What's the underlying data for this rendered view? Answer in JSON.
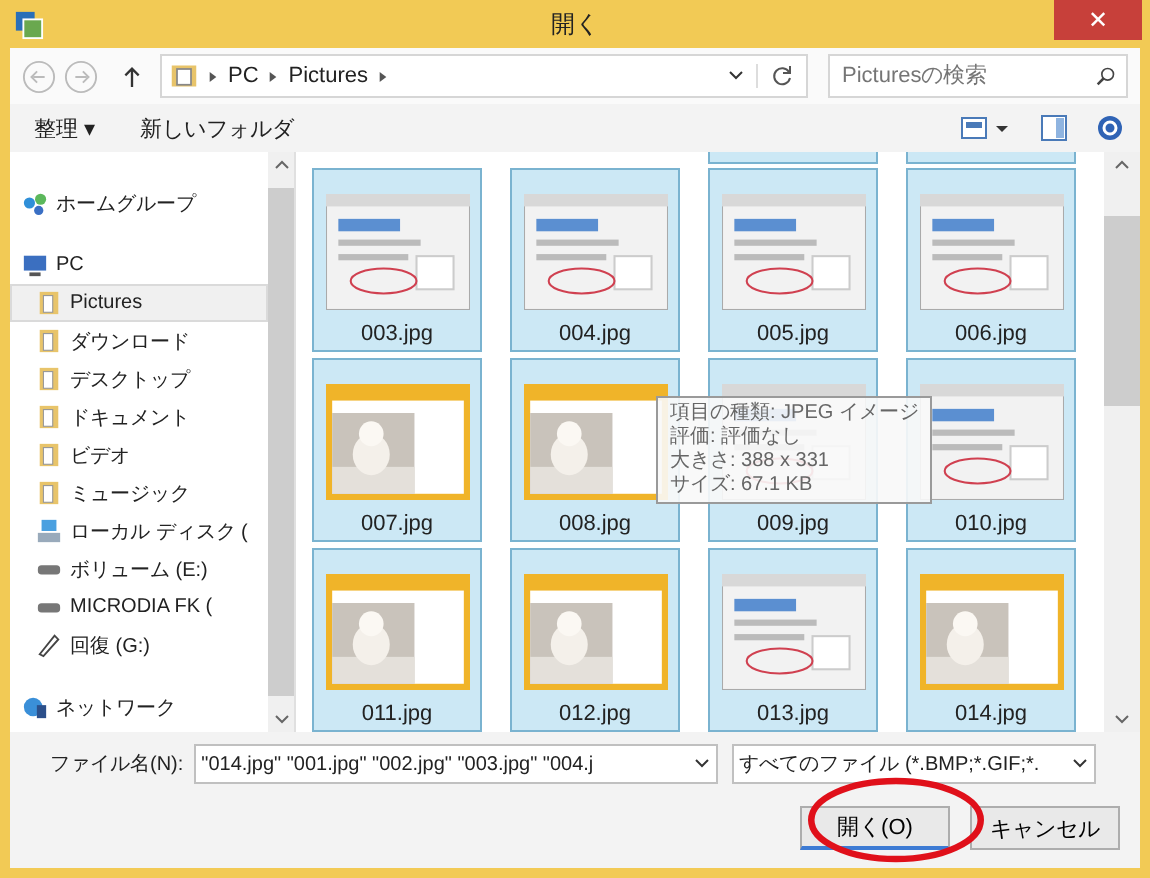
{
  "window": {
    "title": "開く",
    "close": "✕"
  },
  "address": {
    "crumbs": [
      "PC",
      "Pictures"
    ],
    "search_placeholder": "Picturesの検索"
  },
  "toolbar": {
    "organize": "整理 ▾",
    "new_folder": "新しいフォルダ"
  },
  "sidebar": {
    "items": [
      {
        "label": "ホームグループ",
        "kind": "homegroup",
        "selected": false
      },
      {
        "label": "PC",
        "kind": "pc",
        "selected": false,
        "children": [
          {
            "label": "Pictures",
            "kind": "folder",
            "selected": true
          },
          {
            "label": "ダウンロード",
            "kind": "folder",
            "selected": false
          },
          {
            "label": "デスクトップ",
            "kind": "folder",
            "selected": false
          },
          {
            "label": "ドキュメント",
            "kind": "folder",
            "selected": false
          },
          {
            "label": "ビデオ",
            "kind": "folder",
            "selected": false
          },
          {
            "label": "ミュージック",
            "kind": "folder",
            "selected": false
          },
          {
            "label": "ローカル ディスク (",
            "kind": "disk",
            "selected": false
          },
          {
            "label": "ボリューム (E:)",
            "kind": "drive",
            "selected": false
          },
          {
            "label": "MICRODIA FK (",
            "kind": "drive",
            "selected": false
          },
          {
            "label": "回復 (G:)",
            "kind": "pen",
            "selected": false
          }
        ]
      },
      {
        "label": "ネットワーク",
        "kind": "network",
        "selected": false
      }
    ]
  },
  "files": [
    {
      "name": "003.jpg",
      "kind": "screen",
      "selected": true
    },
    {
      "name": "004.jpg",
      "kind": "screen",
      "selected": true
    },
    {
      "name": "005.jpg",
      "kind": "screen",
      "selected": true
    },
    {
      "name": "006.jpg",
      "kind": "screen",
      "selected": true
    },
    {
      "name": "007.jpg",
      "kind": "dog",
      "selected": true
    },
    {
      "name": "008.jpg",
      "kind": "dog",
      "selected": true
    },
    {
      "name": "009.jpg",
      "kind": "screen",
      "selected": true
    },
    {
      "name": "010.jpg",
      "kind": "screen",
      "selected": true
    },
    {
      "name": "011.jpg",
      "kind": "dog",
      "selected": true
    },
    {
      "name": "012.jpg",
      "kind": "dog",
      "selected": true
    },
    {
      "name": "013.jpg",
      "kind": "screen",
      "selected": true
    },
    {
      "name": "014.jpg",
      "kind": "dog",
      "selected": true
    }
  ],
  "tooltip": [
    "項目の種類: JPEG イメージ",
    "評価: 評価なし",
    "大きさ: 388 x 331",
    "サイズ: 67.1 KB"
  ],
  "bottom": {
    "filename_label": "ファイル名(N):",
    "filename": "\"014.jpg\" \"001.jpg\" \"002.jpg\" \"003.jpg\" \"004.j",
    "filter": "すべてのファイル (*.BMP;*.GIF;*.",
    "open": "開く(O)",
    "cancel": "キャンセル"
  }
}
